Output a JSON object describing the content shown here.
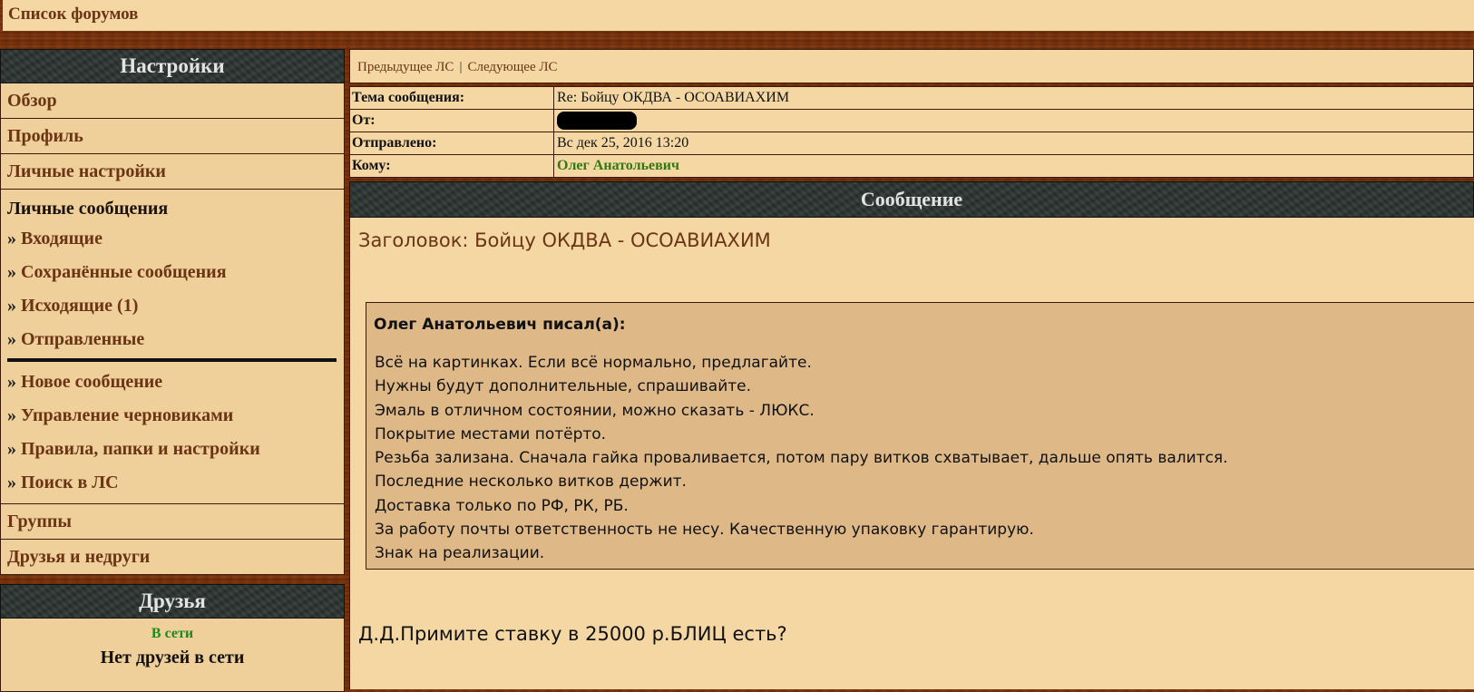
{
  "topbar": {
    "title": "Список форумов"
  },
  "sidebar": {
    "settings_header": "Настройки",
    "overview": "Обзор",
    "profile": "Профиль",
    "personal_settings": "Личные настройки",
    "pm": {
      "title": "Личные сообщения",
      "links_top": [
        "Входящие",
        "Сохранённые сообщения",
        "Исходящие (1)",
        "Отправленные"
      ],
      "links_bottom": [
        "Новое сообщение",
        "Управление черновиками",
        "Правила, папки и настройки",
        "Поиск в ЛС"
      ],
      "arrow": "»"
    },
    "groups": "Группы",
    "friends_foes": "Друзья и недруги",
    "friends_header": "Друзья",
    "online_label": "В сети",
    "no_friends": "Нет друзей в сети"
  },
  "nav": {
    "prev": "Предыдущее ЛС",
    "separator": "|",
    "next": "Следующее ЛС"
  },
  "header": {
    "subject_label": "Тема сообщения:",
    "subject_value": "Re: Бойцу ОКДВА - ОСОАВИАХИМ",
    "from_label": "От:",
    "sent_label": "Отправлено:",
    "sent_value": "Вс дек 25, 2016 13:20",
    "to_label": "Кому:",
    "to_value": "Олег Анатольевич"
  },
  "message": {
    "header": "Сообщение",
    "subject_line": "Заголовок: Бойцу ОКДВА - ОСОАВИАХИМ",
    "quote_author": "Олег Анатольевич писал(а):",
    "quote_lines": [
      "Всё на картинках. Если всё нормально, предлагайте.",
      "Нужны будут дополнительные, спрашивайте.",
      "Эмаль в отличном состоянии, можно сказать - ЛЮКС.",
      "Покрытие местами потёрто.",
      "Резьба зализана. Сначала гайка проваливается, потом пару витков схватывает, дальше опять валится.",
      "Последние несколько витков держит.",
      "Доставка только по РФ, РК, РБ.",
      "За работу почты ответственность не несу. Качественную упаковку гарантирую.",
      "Знак на реализации."
    ],
    "reply_text": "Д.Д.Примите ставку в 25000 р.БЛИЦ есть?"
  }
}
